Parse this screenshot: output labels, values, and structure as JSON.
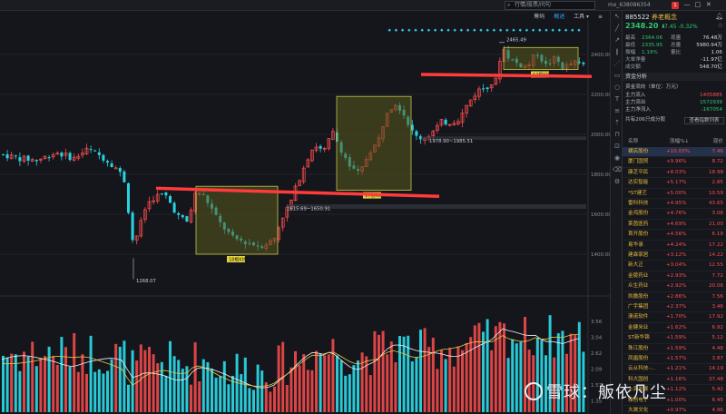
{
  "topbar": {
    "search_placeholder": "行情/股票/问句",
    "user": "mx_638086354",
    "badge": "1",
    "win_controls": [
      "—",
      "□",
      "✕"
    ]
  },
  "subbar": {
    "tabs": [
      {
        "label": "筹码",
        "active": false
      },
      {
        "label": "概述",
        "active": true
      },
      {
        "label": "工具 ▾",
        "active": false
      },
      {
        "label": "≡",
        "active": false
      }
    ]
  },
  "chart": {
    "price_ticks": [
      "2400.00",
      "2200.00",
      "2000.00",
      "1800.00",
      "1600.00",
      "1400.00"
    ],
    "volume_ticks": [
      "3.56",
      "3.04",
      "2.62",
      "2.09",
      "1.57",
      "1.35"
    ],
    "annotations": {
      "high": "2465.49",
      "low": "1268.07",
      "range1": "1615.69~1650.91",
      "range2": "1978.90~1985.51",
      "box1": "18根K线",
      "box2": "17根K线",
      "box3": "12根K线"
    }
  },
  "rpanel": {
    "code": "885522",
    "name": "养老概念",
    "price": "2348.20",
    "arrow": "⬇",
    "change": "-7.45  -0.32%",
    "stats": [
      {
        "k": "最高",
        "v1": "2364.06",
        "k2": "现量",
        "v2": "76.48万"
      },
      {
        "k": "最低",
        "v1": "2335.95",
        "k2": "总量",
        "v2": "5980.94万"
      },
      {
        "k": "振幅",
        "v1": "1.19%",
        "k2": "量比",
        "v2": "1.06"
      },
      {
        "k": "大单净量",
        "v1": "",
        "k2": "",
        "v2": "-11.97亿"
      },
      {
        "k": "成交额",
        "v1": "",
        "k2": "",
        "v2": "548.70亿"
      }
    ],
    "fund_section": "资金分析",
    "fund_sub": "资金流向（单位：万元）",
    "flows": [
      {
        "k": "主力流入",
        "v": "1405885",
        "color": "#ff4d4d"
      },
      {
        "k": "主力流出",
        "v": "1572939",
        "color": "#2ec86a"
      },
      {
        "k": "主力净流入",
        "v": "-167054",
        "color": "#2ec86a"
      }
    ],
    "constituents_title": "共有206只成分股",
    "constituents_btn": "查看指数列表",
    "list_head": {
      "name": "名称",
      "pct": "涨幅%↓",
      "price": "现价"
    },
    "stocks": [
      {
        "name": "横店股份",
        "pct": "+10.03%",
        "price": "7.46"
      },
      {
        "name": "厦门国贸",
        "pct": "+9.96%",
        "price": "8.72"
      },
      {
        "name": "康芝平民",
        "pct": "+8.03%",
        "price": "18.98"
      },
      {
        "name": "达实智能",
        "pct": "+5.17%",
        "price": "2.85"
      },
      {
        "name": "*ST建艺",
        "pct": "+5.00%",
        "price": "10.59"
      },
      {
        "name": "雷科科技",
        "pct": "+4.95%",
        "price": "43.65"
      },
      {
        "name": "金鸿股份",
        "pct": "+4.76%",
        "price": "3.08"
      },
      {
        "name": "莱茵医药",
        "pct": "+4.69%",
        "price": "21.00"
      },
      {
        "name": "首开股份",
        "pct": "+4.56%",
        "price": "6.19"
      },
      {
        "name": "易华录",
        "pct": "+4.24%",
        "price": "17.22"
      },
      {
        "name": "建霖家居",
        "pct": "+3.12%",
        "price": "14.22"
      },
      {
        "name": "新大正",
        "pct": "+3.04%",
        "price": "12.55"
      },
      {
        "name": "金陵药业",
        "pct": "+2.93%",
        "price": "7.72"
      },
      {
        "name": "众生药业",
        "pct": "+2.92%",
        "price": "20.06"
      },
      {
        "name": "凯撒股份",
        "pct": "+2.86%",
        "price": "7.56"
      },
      {
        "name": "广宇集团",
        "pct": "+2.37%",
        "price": "3.46"
      },
      {
        "name": "澳诺软件",
        "pct": "+1.70%",
        "price": "17.92"
      },
      {
        "name": "金健米业",
        "pct": "+1.62%",
        "price": "6.92"
      },
      {
        "name": "ST新华锦",
        "pct": "+1.59%",
        "price": "5.12"
      },
      {
        "name": "珠江股份",
        "pct": "+1.59%",
        "price": "4.48"
      },
      {
        "name": "凤凰股份",
        "pct": "+1.57%",
        "price": "3.87"
      },
      {
        "name": "云从科技-…",
        "pct": "+1.21%",
        "price": "14.19"
      },
      {
        "name": "科大国创",
        "pct": "+1.16%",
        "price": "37.48"
      },
      {
        "name": "上实发展",
        "pct": "+1.12%",
        "price": "5.42"
      },
      {
        "name": "雅创电子",
        "pct": "+1.00%",
        "price": "6.45"
      },
      {
        "name": "大晟文化",
        "pct": "+0.97%",
        "price": "4.96"
      },
      {
        "name": "中天服务",
        "pct": "+0.96%",
        "price": "6.32"
      }
    ]
  },
  "watermark": "雪球：舨依凡尘",
  "colors": {
    "up": "#ff4d4d",
    "down": "#2ad3e0",
    "trend_line": "#ff3b3b",
    "box_fill": "#5a5a1e",
    "box_border": "#c8c848"
  }
}
